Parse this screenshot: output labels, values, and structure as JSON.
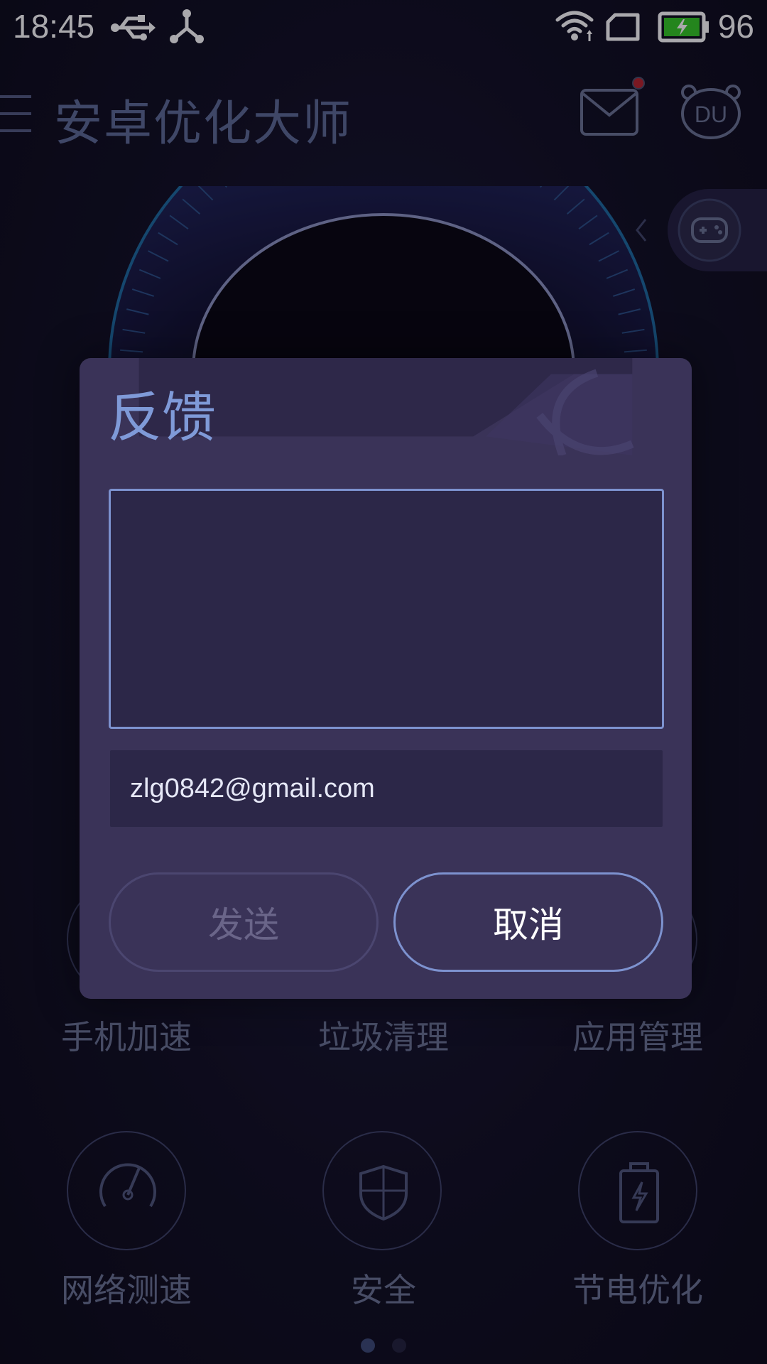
{
  "status_bar": {
    "time": "18:45",
    "battery_level": "96",
    "icons": [
      "usb-icon",
      "share-icon",
      "wifi-icon",
      "sim-icon",
      "battery-icon"
    ],
    "battery_color": "#34c924"
  },
  "app_bar": {
    "title": "安卓优化大师",
    "icons": [
      "menu-icon",
      "mail-icon",
      "du-avatar-icon"
    ],
    "notification_color": "#b8232c"
  },
  "side_tab": {
    "icon": "gamepad-icon"
  },
  "features": [
    {
      "label": "手机加速",
      "icon": "rocket-icon"
    },
    {
      "label": "垃圾清理",
      "icon": "broom-icon"
    },
    {
      "label": "应用管理",
      "icon": "apps-icon"
    },
    {
      "label": "网络测速",
      "icon": "speedometer-icon"
    },
    {
      "label": "安全",
      "icon": "shield-icon"
    },
    {
      "label": "节电优化",
      "icon": "battery-saver-icon"
    }
  ],
  "pager": {
    "count": 2,
    "active_index": 0
  },
  "dialog": {
    "title": "反馈",
    "feedback_text": "",
    "email_value": "zlg0842@gmail.com",
    "send_label": "发送",
    "cancel_label": "取消",
    "send_enabled": false
  },
  "colors": {
    "accent": "#7d92cf",
    "dialog_bg": "#3a3358",
    "title_color": "#7f9ad8"
  }
}
